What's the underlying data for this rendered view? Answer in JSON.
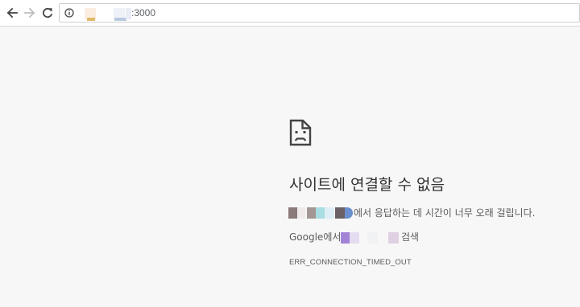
{
  "browser": {
    "back_icon": "arrow-left-icon",
    "forward_icon": "arrow-right-icon",
    "reload_icon": "reload-icon",
    "site_info_icon": "info-circle-icon",
    "url_port": ":3000"
  },
  "error_page": {
    "icon": "sad-document-icon",
    "title": "사이트에 연결할 수 없음",
    "timeout_message": "에서 응답하는 데 시간이 너무 오래 걸립니다.",
    "search_prefix": "Google에서",
    "search_suffix": "검색",
    "error_code": "ERR_CONNECTION_TIMED_OUT"
  }
}
